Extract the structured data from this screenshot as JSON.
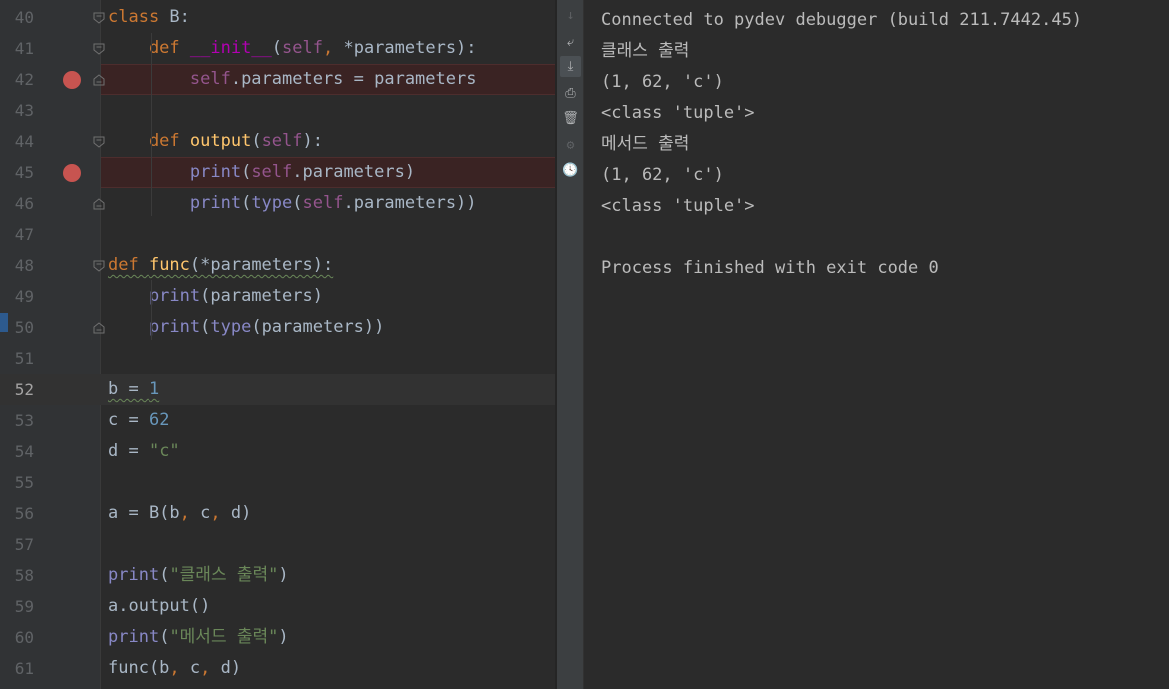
{
  "editor": {
    "lines": [
      {
        "no": "40",
        "tokens": [
          {
            "t": "class",
            "c": "kw"
          },
          {
            "t": " B:",
            "c": "op"
          }
        ]
      },
      {
        "no": "41",
        "tokens": [
          {
            "t": "    def ",
            "c": "kw"
          },
          {
            "t": "__init__",
            "c": "magic"
          },
          {
            "t": "(",
            "c": "op"
          },
          {
            "t": "self",
            "c": "self"
          },
          {
            "t": ", ",
            "c": "kw"
          },
          {
            "t": "*parameters):",
            "c": "op"
          }
        ]
      },
      {
        "no": "42",
        "breakpoint": true,
        "tokens": [
          {
            "t": "        self",
            "c": "self"
          },
          {
            "t": ".parameters = parameters",
            "c": "op"
          }
        ]
      },
      {
        "no": "43",
        "tokens": []
      },
      {
        "no": "44",
        "tokens": [
          {
            "t": "    def ",
            "c": "kw"
          },
          {
            "t": "output",
            "c": "fn"
          },
          {
            "t": "(",
            "c": "op"
          },
          {
            "t": "self",
            "c": "self"
          },
          {
            "t": "):",
            "c": "op"
          }
        ]
      },
      {
        "no": "45",
        "breakpoint": true,
        "tokens": [
          {
            "t": "        print",
            "c": "bi"
          },
          {
            "t": "(",
            "c": "op"
          },
          {
            "t": "self",
            "c": "self"
          },
          {
            "t": ".parameters)",
            "c": "op"
          }
        ]
      },
      {
        "no": "46",
        "tokens": [
          {
            "t": "        print",
            "c": "bi"
          },
          {
            "t": "(",
            "c": "op"
          },
          {
            "t": "type",
            "c": "bi"
          },
          {
            "t": "(",
            "c": "op"
          },
          {
            "t": "self",
            "c": "self"
          },
          {
            "t": ".parameters))",
            "c": "op"
          }
        ]
      },
      {
        "no": "47",
        "tokens": []
      },
      {
        "no": "48",
        "tokens": [
          {
            "t": "def ",
            "c": "kw"
          },
          {
            "t": "func",
            "c": "fn"
          },
          {
            "t": "(*parameters):",
            "c": "op"
          }
        ]
      },
      {
        "no": "49",
        "tokens": [
          {
            "t": "    print",
            "c": "bi"
          },
          {
            "t": "(parameters)",
            "c": "op"
          }
        ]
      },
      {
        "no": "50",
        "tokens": [
          {
            "t": "    print",
            "c": "bi"
          },
          {
            "t": "(",
            "c": "op"
          },
          {
            "t": "type",
            "c": "bi"
          },
          {
            "t": "(parameters))",
            "c": "op"
          }
        ]
      },
      {
        "no": "51",
        "tokens": []
      },
      {
        "no": "52",
        "current": true,
        "tokens": [
          {
            "t": "b = ",
            "c": "op"
          },
          {
            "t": "1",
            "c": "num"
          }
        ]
      },
      {
        "no": "53",
        "tokens": [
          {
            "t": "c = ",
            "c": "op"
          },
          {
            "t": "62",
            "c": "num"
          }
        ]
      },
      {
        "no": "54",
        "tokens": [
          {
            "t": "d = ",
            "c": "op"
          },
          {
            "t": "\"c\"",
            "c": "str"
          }
        ]
      },
      {
        "no": "55",
        "tokens": []
      },
      {
        "no": "56",
        "tokens": [
          {
            "t": "a = B(b",
            "c": "op"
          },
          {
            "t": ", ",
            "c": "kw"
          },
          {
            "t": "c",
            "c": "op"
          },
          {
            "t": ", ",
            "c": "kw"
          },
          {
            "t": "d)",
            "c": "op"
          }
        ]
      },
      {
        "no": "57",
        "tokens": []
      },
      {
        "no": "58",
        "tokens": [
          {
            "t": "print",
            "c": "bi"
          },
          {
            "t": "(",
            "c": "op"
          },
          {
            "t": "\"클래스 출력\"",
            "c": "str"
          },
          {
            "t": ")",
            "c": "op"
          }
        ]
      },
      {
        "no": "59",
        "tokens": [
          {
            "t": "a.output()",
            "c": "op"
          }
        ]
      },
      {
        "no": "60",
        "tokens": [
          {
            "t": "print",
            "c": "bi"
          },
          {
            "t": "(",
            "c": "op"
          },
          {
            "t": "\"메서드 출력\"",
            "c": "str"
          },
          {
            "t": ")",
            "c": "op"
          }
        ]
      },
      {
        "no": "61",
        "tokens": [
          {
            "t": "func(b",
            "c": "op"
          },
          {
            "t": ", ",
            "c": "kw"
          },
          {
            "t": "c",
            "c": "op"
          },
          {
            "t": ", ",
            "c": "kw"
          },
          {
            "t": "d)",
            "c": "op"
          }
        ]
      }
    ]
  },
  "toolbar": {
    "icons": [
      {
        "name": "scroll-down-arrow-icon",
        "glyph": "↓",
        "dim": true
      },
      {
        "name": "soft-wrap-icon",
        "glyph": "⤶"
      },
      {
        "name": "scroll-to-end-icon",
        "glyph": "⤓",
        "active": true
      },
      {
        "name": "print-icon",
        "glyph": "⎙"
      },
      {
        "name": "trash-icon",
        "glyph": "🗑"
      },
      {
        "name": "settings-icon",
        "glyph": "⚙",
        "dim": true
      },
      {
        "name": "history-clock-icon",
        "glyph": "🕓"
      }
    ]
  },
  "console": {
    "lines": [
      "Connected to pydev debugger (build 211.7442.45)",
      "클래스 출력",
      "(1, 62, 'c')",
      "<class 'tuple'>",
      "메서드 출력",
      "(1, 62, 'c')",
      "<class 'tuple'>",
      "",
      "Process finished with exit code 0"
    ]
  }
}
